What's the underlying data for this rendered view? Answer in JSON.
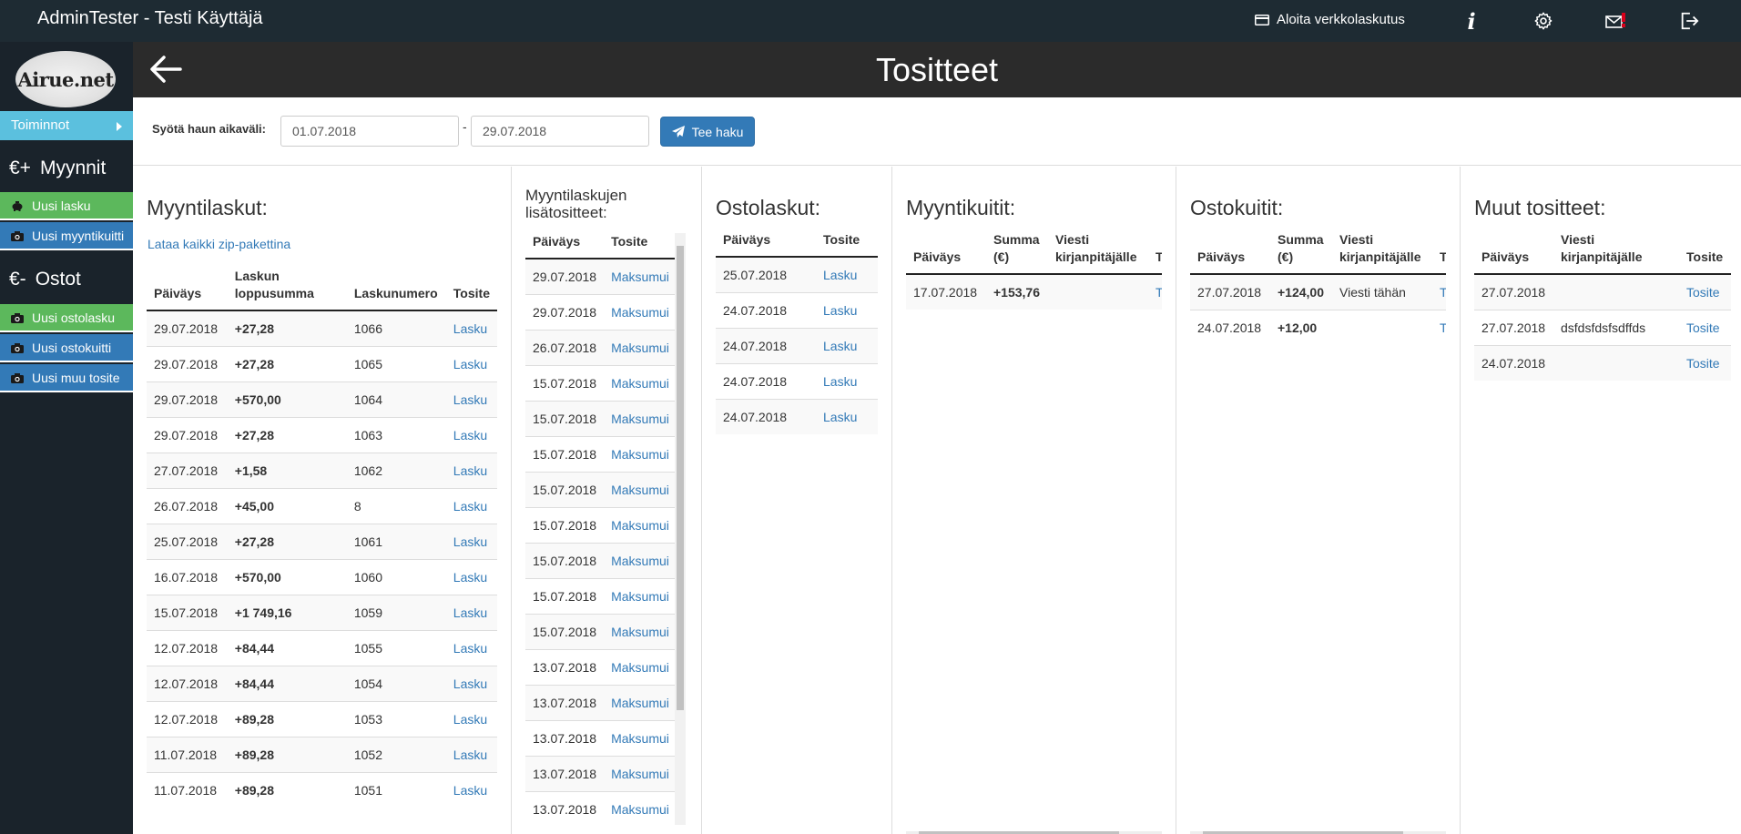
{
  "topbar": {
    "user": "AdminTester - Testi Käyttäjä",
    "einvoice_label": "Aloita verkkolaskutus"
  },
  "sidebar": {
    "logo_text": "Airue.net",
    "toiminnot_label": "Toiminnot",
    "sales_heading": "Myynnit",
    "sales_prefix": "€+",
    "new_invoice": "Uusi lasku",
    "new_sales_receipt": "Uusi myyntikuitti",
    "purchases_heading": "Ostot",
    "purchases_prefix": "€-",
    "new_purchase_invoice": "Uusi ostolasku",
    "new_purchase_receipt": "Uusi ostokuitti",
    "new_other_voucher": "Uusi muu tosite"
  },
  "header": {
    "title": "Tositteet"
  },
  "filter": {
    "label": "Syötä haun aikaväli:",
    "date_from": "01.07.2018",
    "separator": "-",
    "date_to": "29.07.2018",
    "search_label": "Tee haku"
  },
  "sales_invoices": {
    "title": "Myyntilaskut:",
    "zip_link": "Lataa kaikki zip-pakettina",
    "columns": [
      "Päiväys",
      "Laskun loppusumma",
      "Laskunumero",
      "Tosite"
    ],
    "rows": [
      {
        "date": "29.07.2018",
        "amount": "+27,28",
        "number": "1066",
        "doc": "Lasku"
      },
      {
        "date": "29.07.2018",
        "amount": "+27,28",
        "number": "1065",
        "doc": "Lasku"
      },
      {
        "date": "29.07.2018",
        "amount": "+570,00",
        "number": "1064",
        "doc": "Lasku"
      },
      {
        "date": "29.07.2018",
        "amount": "+27,28",
        "number": "1063",
        "doc": "Lasku"
      },
      {
        "date": "27.07.2018",
        "amount": "+1,58",
        "number": "1062",
        "doc": "Lasku"
      },
      {
        "date": "26.07.2018",
        "amount": "+45,00",
        "number": "8",
        "doc": "Lasku"
      },
      {
        "date": "25.07.2018",
        "amount": "+27,28",
        "number": "1061",
        "doc": "Lasku"
      },
      {
        "date": "16.07.2018",
        "amount": "+570,00",
        "number": "1060",
        "doc": "Lasku"
      },
      {
        "date": "15.07.2018",
        "amount": "+1 749,16",
        "number": "1059",
        "doc": "Lasku"
      },
      {
        "date": "12.07.2018",
        "amount": "+84,44",
        "number": "1055",
        "doc": "Lasku"
      },
      {
        "date": "12.07.2018",
        "amount": "+84,44",
        "number": "1054",
        "doc": "Lasku"
      },
      {
        "date": "12.07.2018",
        "amount": "+89,28",
        "number": "1053",
        "doc": "Lasku"
      },
      {
        "date": "11.07.2018",
        "amount": "+89,28",
        "number": "1052",
        "doc": "Lasku"
      },
      {
        "date": "11.07.2018",
        "amount": "+89,28",
        "number": "1051",
        "doc": "Lasku"
      }
    ]
  },
  "sales_attachments": {
    "title": "Myyntilaskujen lisätositteet:",
    "columns": [
      "Päiväys",
      "Tosite"
    ],
    "rows": [
      {
        "date": "29.07.2018",
        "doc": "Maksumui"
      },
      {
        "date": "29.07.2018",
        "doc": "Maksumui"
      },
      {
        "date": "26.07.2018",
        "doc": "Maksumui"
      },
      {
        "date": "15.07.2018",
        "doc": "Maksumui"
      },
      {
        "date": "15.07.2018",
        "doc": "Maksumui"
      },
      {
        "date": "15.07.2018",
        "doc": "Maksumui"
      },
      {
        "date": "15.07.2018",
        "doc": "Maksumui"
      },
      {
        "date": "15.07.2018",
        "doc": "Maksumui"
      },
      {
        "date": "15.07.2018",
        "doc": "Maksumui"
      },
      {
        "date": "15.07.2018",
        "doc": "Maksumui"
      },
      {
        "date": "15.07.2018",
        "doc": "Maksumui"
      },
      {
        "date": "13.07.2018",
        "doc": "Maksumui"
      },
      {
        "date": "13.07.2018",
        "doc": "Maksumui"
      },
      {
        "date": "13.07.2018",
        "doc": "Maksumui"
      },
      {
        "date": "13.07.2018",
        "doc": "Maksumui"
      },
      {
        "date": "13.07.2018",
        "doc": "Maksumui"
      }
    ]
  },
  "purchase_invoices": {
    "title": "Ostolaskut:",
    "columns": [
      "Päiväys",
      "Tosite"
    ],
    "rows": [
      {
        "date": "25.07.2018",
        "doc": "Lasku"
      },
      {
        "date": "24.07.2018",
        "doc": "Lasku"
      },
      {
        "date": "24.07.2018",
        "doc": "Lasku"
      },
      {
        "date": "24.07.2018",
        "doc": "Lasku"
      },
      {
        "date": "24.07.2018",
        "doc": "Lasku"
      }
    ]
  },
  "sales_receipts": {
    "title": "Myyntikuitit:",
    "columns": [
      "Päiväys",
      "Summa (€)",
      "Viesti kirjanpitäjälle",
      "To"
    ],
    "rows": [
      {
        "date": "17.07.2018",
        "amount": "+153,76",
        "message": "",
        "doc": "To"
      }
    ]
  },
  "purchase_receipts": {
    "title": "Ostokuitit:",
    "columns": [
      "Päiväys",
      "Summa (€)",
      "Viesti kirjanpitäjälle",
      "To"
    ],
    "rows": [
      {
        "date": "27.07.2018",
        "amount": "+124,00",
        "message": "Viesti tähän",
        "doc": "To"
      },
      {
        "date": "24.07.2018",
        "amount": "+12,00",
        "message": "",
        "doc": "To"
      }
    ]
  },
  "other_vouchers": {
    "title": "Muut tositteet:",
    "columns": [
      "Päiväys",
      "Viesti kirjanpitäjälle",
      "Tosite"
    ],
    "rows": [
      {
        "date": "27.07.2018",
        "message": "",
        "doc": "Tosite"
      },
      {
        "date": "27.07.2018",
        "message": "dsfdsfdsfsdffds",
        "doc": "Tosite"
      },
      {
        "date": "24.07.2018",
        "message": "",
        "doc": "Tosite"
      }
    ]
  },
  "colors": {
    "topbar": "#1e2b33",
    "sidebar": "#1a232b",
    "header": "#2b2b2b",
    "green": "#5cb85c",
    "blue": "#337ab7",
    "info": "#5bc0de",
    "notification": "#d9001b"
  },
  "icons": [
    "credit-card-icon",
    "info-icon",
    "gear-icon",
    "mail-alert-icon",
    "logout-icon",
    "arrow-left-icon",
    "piggy-bank-icon",
    "camera-icon",
    "paper-plane-icon"
  ]
}
